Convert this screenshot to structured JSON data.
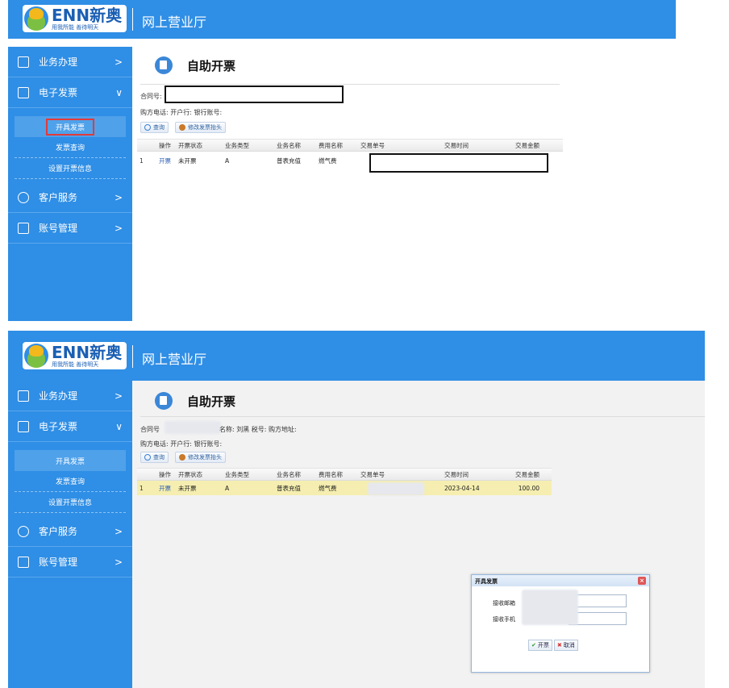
{
  "brand": {
    "name": "ENN新奥",
    "slogan": "用我所能 善待明天"
  },
  "app_title": "网上营业厅",
  "page_title": "自助开票",
  "nav": [
    {
      "label": "业务办理",
      "arrow": ">"
    },
    {
      "label": "电子发票",
      "arrow": "∨"
    },
    {
      "label": "客户服务",
      "arrow": ">"
    },
    {
      "label": "账号管理",
      "arrow": ">"
    }
  ],
  "sub_nav": [
    "开具发票",
    "发票查询",
    "设置开票信息"
  ],
  "form": {
    "contract_label": "合同号:",
    "contract_label_2": "合同号",
    "row1_rest": "名称: 刘黑  税号:  购方地址:",
    "row2": "购方电话:  开户行:  银行账号:"
  },
  "buttons": {
    "query": "查询",
    "edit_header": "修改发票抬头"
  },
  "table": {
    "headers": [
      "操作",
      "开票状态",
      "业务类型",
      "业务名称",
      "费用名称",
      "交易单号",
      "交易时间",
      "交易金额"
    ],
    "row_index": "1",
    "row": {
      "action": "开票",
      "status": "未开票",
      "biz_type": "A",
      "biz_name": "普表充值",
      "fee_name": "燃气费",
      "trade_time": "2023-04-14",
      "amount": "100.00"
    }
  },
  "dialog": {
    "title": "开具发票",
    "close": "×",
    "email_label": "接收邮箱",
    "phone_label": "接收手机",
    "ok": "开票",
    "cancel": "取消",
    "ok_icon": "check-icon",
    "cancel_icon": "cross-icon"
  },
  "colors": {
    "primary": "#2f8ee5",
    "highlight_row": "#f5eeb0",
    "annotation": "#e23a3a"
  }
}
